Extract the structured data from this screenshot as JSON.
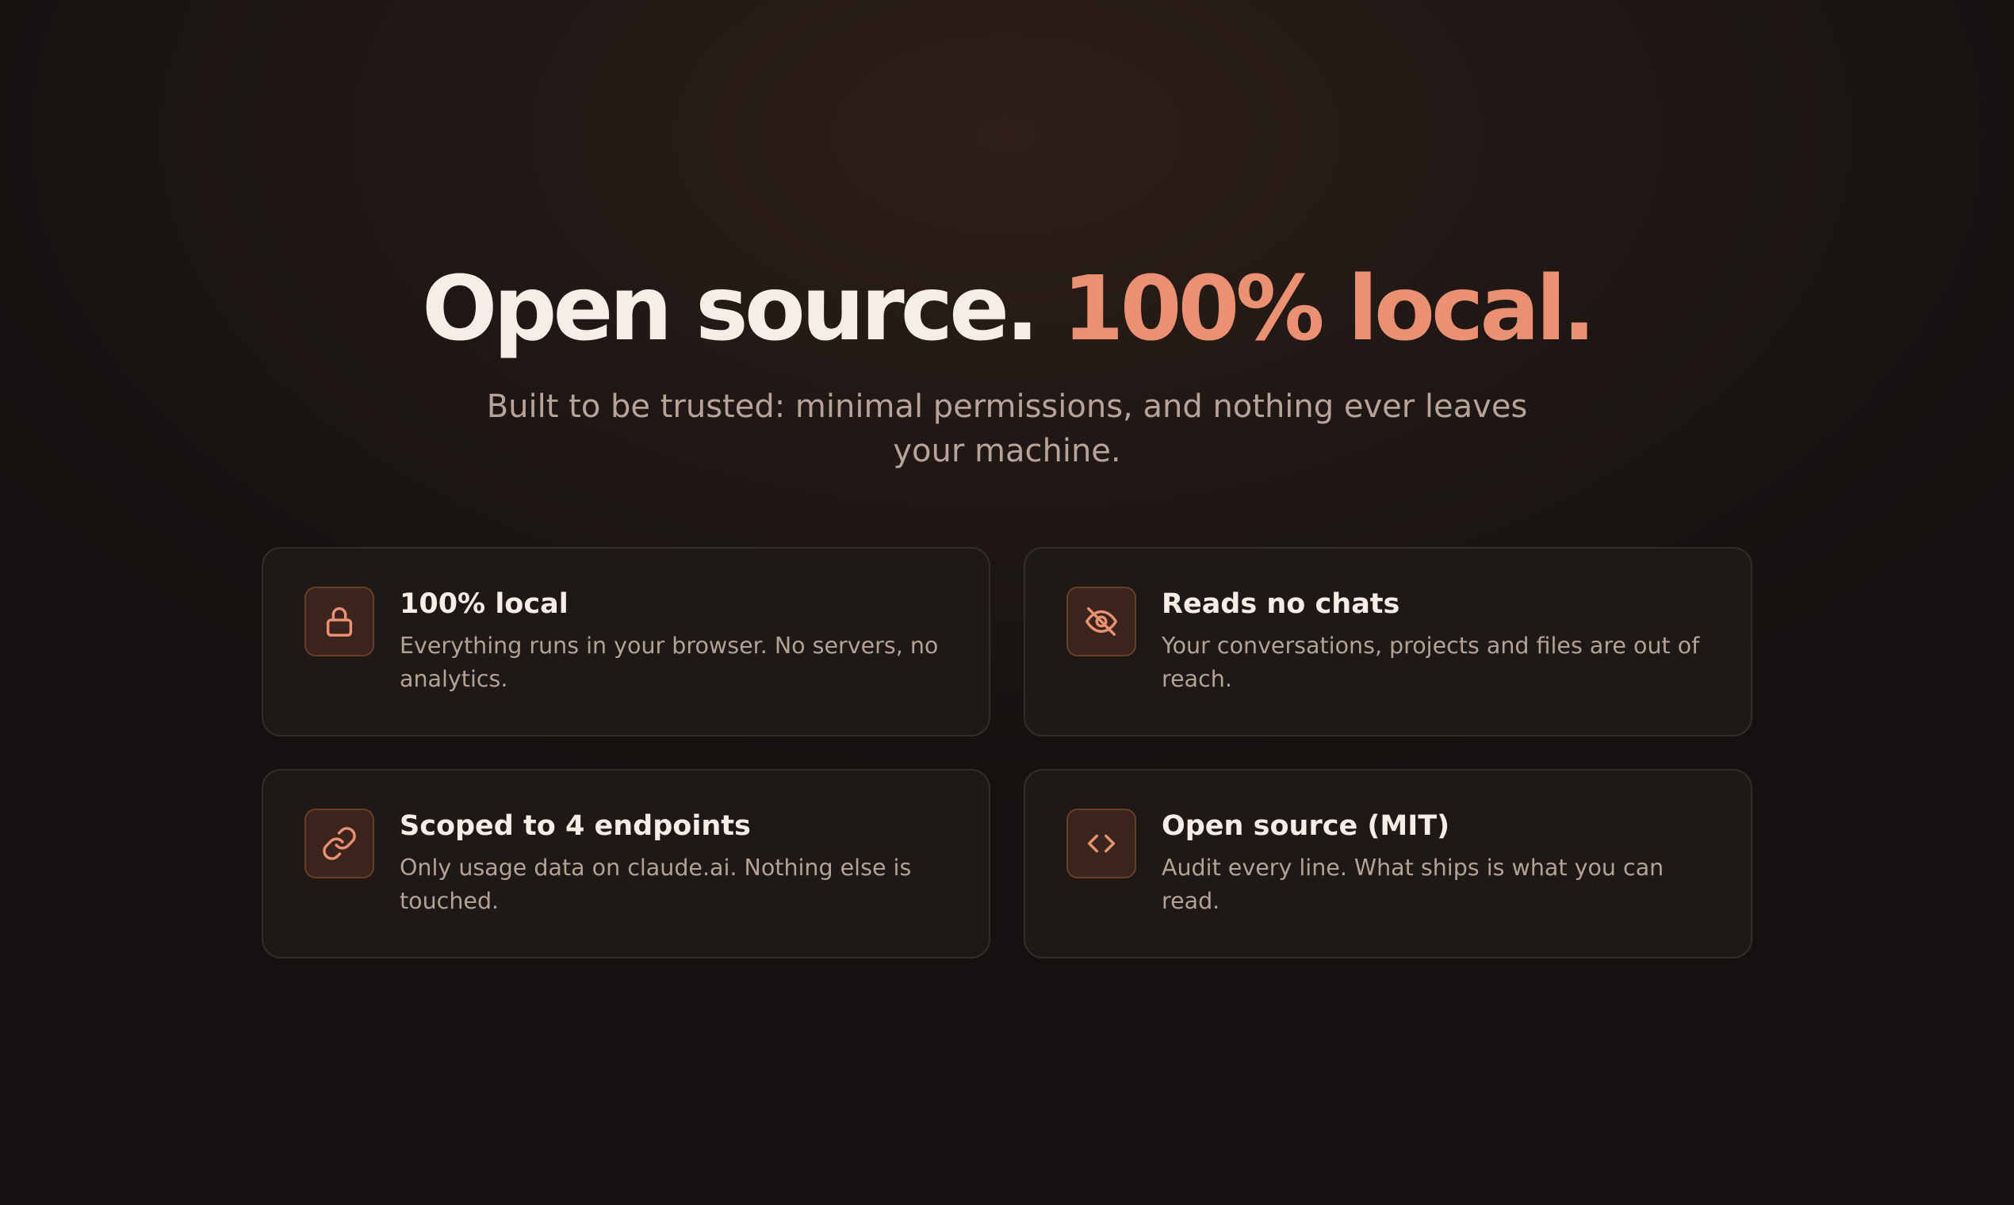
{
  "hero": {
    "headline_main": "Open source.",
    "headline_accent": "100% local.",
    "subtitle": "Built to be trusted: minimal permissions, and nothing ever leaves your machine."
  },
  "features": [
    {
      "icon": "lock-icon",
      "title": "100% local",
      "description": "Everything runs in your browser. No servers, no analytics."
    },
    {
      "icon": "eye-off-icon",
      "title": "Reads no chats",
      "description": "Your conversations, projects and files are out of reach."
    },
    {
      "icon": "link-icon",
      "title": "Scoped to 4 endpoints",
      "description": "Only usage data on claude.ai. Nothing else is touched."
    },
    {
      "icon": "code-icon",
      "title": "Open source (MIT)",
      "description": "Audit every line. What ships is what you can read."
    }
  ],
  "colors": {
    "background": "#141110",
    "accent": "#ea9174",
    "card_background": "#1e1917",
    "card_border": "#342c28",
    "icon_background": "#3a241c"
  }
}
